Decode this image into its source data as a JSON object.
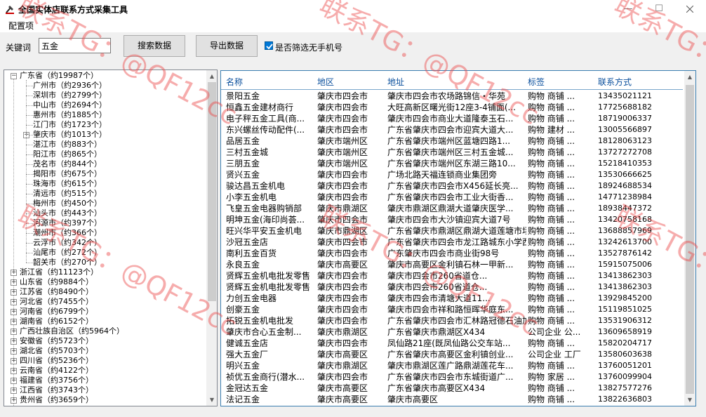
{
  "window": {
    "title": "全国实体店联系方式采集工具",
    "min": "—",
    "max": "☐"
  },
  "menu": {
    "config": "配置项"
  },
  "toolbar": {
    "keyword_label": "关键词",
    "keyword_value": "五金",
    "search_label": "搜索数据",
    "export_label": "导出数据",
    "filter_label": "是否筛选无手机号",
    "filter_checked": true
  },
  "tree": [
    {
      "label": "广东省（约19987个）",
      "level": 0,
      "expander": "minus"
    },
    {
      "label": "广州市（约2936个）",
      "level": 1
    },
    {
      "label": "深圳市（约2799个）",
      "level": 1
    },
    {
      "label": "中山市（约2694个）",
      "level": 1
    },
    {
      "label": "惠州市（约1885个）",
      "level": 1
    },
    {
      "label": "江门市（约1723个）",
      "level": 1
    },
    {
      "label": "肇庆市（约1013个）",
      "level": 1,
      "expander": "plus"
    },
    {
      "label": "湛江市（约883个）",
      "level": 1
    },
    {
      "label": "阳江市（约865个）",
      "level": 1
    },
    {
      "label": "茂名市（约844个）",
      "level": 1
    },
    {
      "label": "揭阳市（约675个）",
      "level": 1
    },
    {
      "label": "珠海市（约615个）",
      "level": 1
    },
    {
      "label": "清远市（约515个）",
      "level": 1
    },
    {
      "label": "梅州市（约450个）",
      "level": 1
    },
    {
      "label": "汕头市（约443个）",
      "level": 1
    },
    {
      "label": "河源市（约397个）",
      "level": 1
    },
    {
      "label": "潮州市（约366个）",
      "level": 1
    },
    {
      "label": "云浮市（约342个）",
      "level": 1
    },
    {
      "label": "汕尾市（约272个）",
      "level": 1
    },
    {
      "label": "韶关市（约270个）",
      "level": 1
    },
    {
      "label": "浙江省（约11123个）",
      "level": 0,
      "expander": "plus"
    },
    {
      "label": "山东省（约9884个）",
      "level": 0,
      "expander": "plus"
    },
    {
      "label": "江苏省（约8490个）",
      "level": 0,
      "expander": "plus"
    },
    {
      "label": "河北省（约7455个）",
      "level": 0,
      "expander": "plus"
    },
    {
      "label": "河南省（约6799个）",
      "level": 0,
      "expander": "plus"
    },
    {
      "label": "湖南省（约6152个）",
      "level": 0,
      "expander": "plus"
    },
    {
      "label": "广西壮族自治区（约5964个）",
      "level": 0,
      "expander": "plus"
    },
    {
      "label": "安徽省（约5723个）",
      "level": 0,
      "expander": "plus"
    },
    {
      "label": "湖北省（约5703个）",
      "level": 0,
      "expander": "plus"
    },
    {
      "label": "四川省（约5236个）",
      "level": 0,
      "expander": "plus"
    },
    {
      "label": "云南省（约4122个）",
      "level": 0,
      "expander": "plus"
    },
    {
      "label": "福建省（约3756个）",
      "level": 0,
      "expander": "plus"
    },
    {
      "label": "江西省（约3743个）",
      "level": 0,
      "expander": "plus"
    },
    {
      "label": "贵州省（约3659个）",
      "level": 0,
      "expander": "plus"
    }
  ],
  "grid": {
    "columns": [
      "名称",
      "地区",
      "地址",
      "标签",
      "联系方式"
    ],
    "rows": [
      [
        "景阳五金",
        "肇庆市四会市",
        "肇庆市四会市农场路锦信・华苑",
        "购物 商铺 ...",
        "13435021121"
      ],
      [
        "恒鑫五金建材商行",
        "肇庆市四会市",
        "大旺高新区曙光街12座3-4铺面(...",
        "购物 商铺 ...",
        "17725688182"
      ],
      [
        "电子秤五金工具(商...",
        "肇庆市四会市",
        "肇庆市四会市商业大道隆泰玉石...",
        "购物 商铺 ...",
        "18719006337"
      ],
      [
        "东兴螺丝传动配件(...",
        "肇庆市四会市",
        "广东省肇庆市四会市迎宾大道大...",
        "购物 建材 ...",
        "13005566897"
      ],
      [
        "品居五金",
        "肇庆市端州区",
        "广东省肇庆市端州区蓝塘四路1...",
        "购物 商铺 ...",
        "18128063123"
      ],
      [
        "三村五金城",
        "肇庆市端州区",
        "广东省肇庆市端州区三村五金城...",
        "购物 商铺 ...",
        "13727272708"
      ],
      [
        "三朋五金",
        "肇庆市端州区",
        "广东省肇庆市端州区东湖三路10...",
        "购物 商铺 ...",
        "15218410353"
      ],
      [
        "贤兴五金",
        "肇庆市四会市",
        "广场北路天福连锁商业集团旁",
        "购物 商铺 ...",
        "13530666625"
      ],
      [
        "骏达昌五金机电",
        "肇庆市四会市",
        "广东省肇庆市四会市X456延长亮...",
        "购物 商铺 ...",
        "18924688534"
      ],
      [
        "小李五金机电",
        "肇庆市四会市",
        "广东省肇庆市四会市工业大街香...",
        "购物 商铺 ...",
        "14771238984"
      ],
      [
        "飞皇五金电器购销部",
        "肇庆市鼎湖区",
        "肇庆市鼎湖区鼎湖大道肇庆医学...",
        "购物 商铺 ...",
        "18938447372"
      ],
      [
        "明坤五金(海印尚荟...",
        "肇庆市四会市",
        "肇庆市四会市大沙镇迎宾大道7号",
        "购物 商铺 ...",
        "13420758168"
      ],
      [
        "旺兴华平安五金机电",
        "肇庆市鼎湖区",
        "广东省肇庆市鼎湖区鼎湖大道莲塘市场...",
        "购物 商铺 ...",
        "13688857969"
      ],
      [
        "沙冠五金店",
        "肇庆市四会市",
        "广东省肇庆市四会市龙江路城东小学西...",
        "购物 商铺 ...",
        "13242613700"
      ],
      [
        "南利五金百货",
        "肇庆市四会市",
        "广东肇庆市四会市商业街98号",
        "购物 商铺 ...",
        "13527876142"
      ],
      [
        "永良五金",
        "肇庆市高要区",
        "肇庆市高要区金利镇石林一甲新...",
        "购物 商铺 ...",
        "15915075006"
      ],
      [
        "贤辉五金机电批发零售",
        "肇庆市四会市",
        "肇庆市四会市260省道仓...",
        "购物 商铺 ...",
        "13413862303"
      ],
      [
        "贤辉五金机电批发零售",
        "肇庆市四会市",
        "肇庆市四会市260省道仓...",
        "购物 商铺 ...",
        "13413862303"
      ],
      [
        "力创五金电器",
        "肇庆市四会市",
        "肇庆市四会市清塘大道11...",
        "购物 商铺 ...",
        "13929845200"
      ],
      [
        "创豪五金",
        "肇庆市四会市",
        "肇庆市四会市祥和路恒晖华庭东...",
        "购物 商铺 ...",
        "15119851025"
      ],
      [
        "拓锐五金机电批发",
        "肇庆市四会市",
        "广东省肇庆市四会市汇林路冠德石油加...",
        "购物 商铺 ...",
        "13531906312"
      ],
      [
        "肇庆市合心五金制...",
        "肇庆市鼎湖区",
        "广东省肇庆市鼎湖区X434",
        "公司企业 公...",
        "13609658919"
      ],
      [
        "健诚五金店",
        "肇庆市四会市",
        "凤仙路21座(既凤仙路公交车站...",
        "购物 商铺 ...",
        "15820204717"
      ],
      [
        "强大五金厂",
        "肇庆市高要区",
        "广东省肇庆市高要区金利镇创业...",
        "公司企业 工厂",
        "13580603638"
      ],
      [
        "明兴五金",
        "肇庆市鼎湖区",
        "肇庆市鼎湖区莲广路鼎湖莲花车...",
        "购物 商铺 ...",
        "13760051201"
      ],
      [
        "祯优五金商行(潜水...",
        "肇庆市四会市",
        "广东省肇庆市四会市东城街道广...",
        "购物 家居 ...",
        "13760099904"
      ],
      [
        "金冠达五金",
        "肇庆市高要区",
        "广东省肇庆市高要区X434",
        "购物 商铺 ...",
        "13827577276"
      ],
      [
        "法记五金",
        "肇庆市高要区",
        "肇庆市高要区",
        "购物 商铺 ...",
        "13822636803"
      ]
    ]
  },
  "watermark": {
    "text": "联系TG：@QF12cc"
  },
  "colors": {
    "accent": "#0078d7",
    "header_text": "#0a4f9c",
    "panel_border": "#3c7fb1",
    "watermark": "#eb4646"
  }
}
